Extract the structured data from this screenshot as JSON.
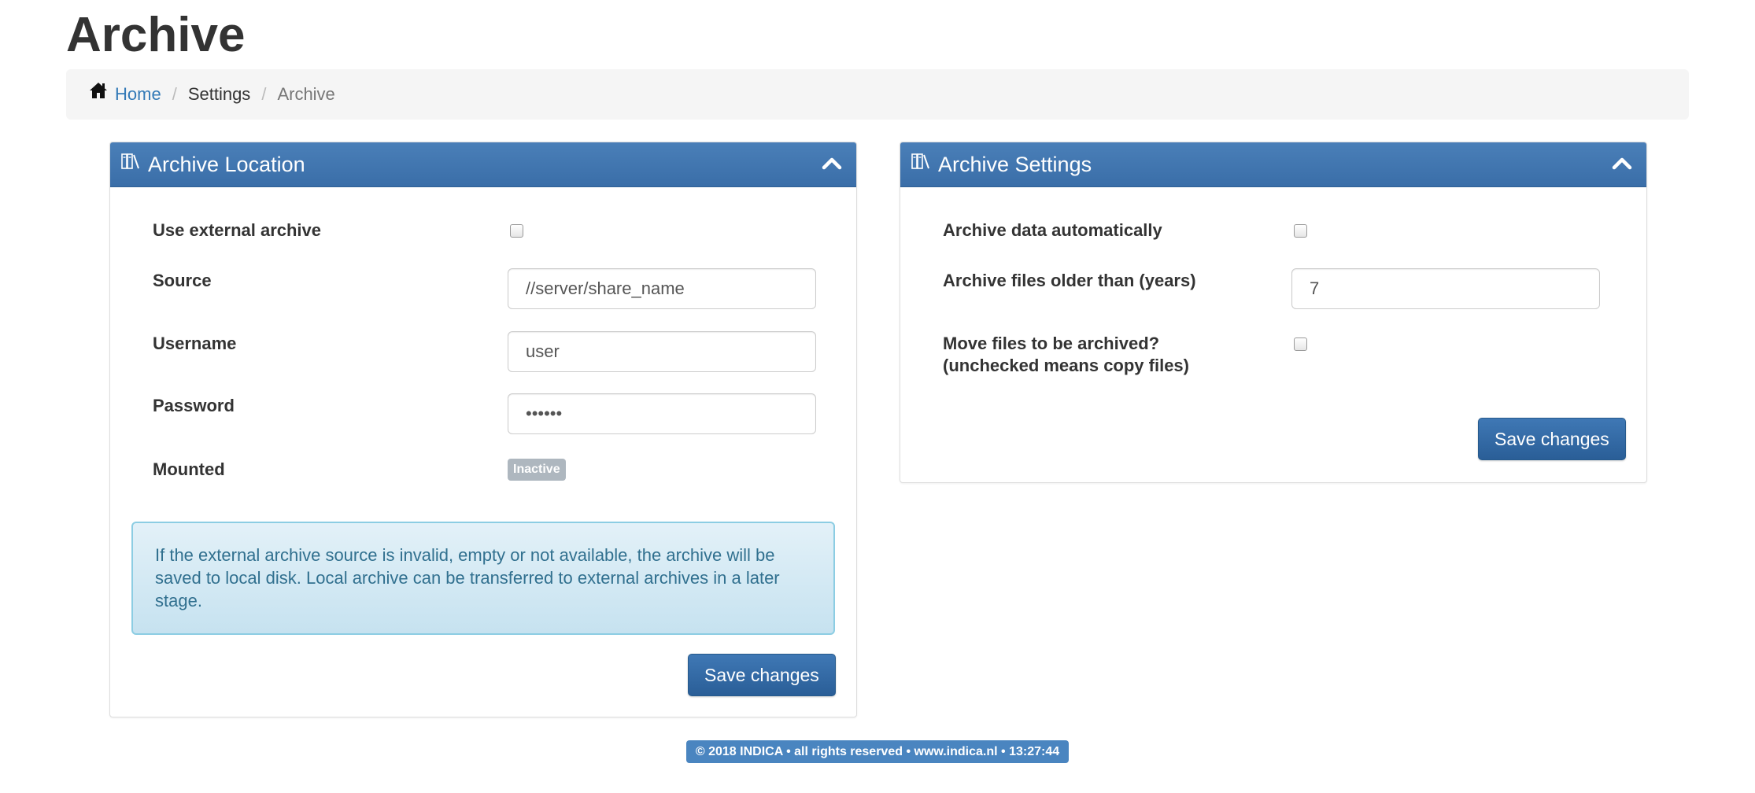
{
  "page": {
    "title": "Archive"
  },
  "breadcrumb": {
    "home_icon": "home-icon",
    "items": [
      "Home",
      "Settings",
      "Archive"
    ],
    "separator": "/"
  },
  "archive_location": {
    "title": "Archive Location",
    "icon": "archive-books-icon",
    "collapse_icon": "chevron-up-icon",
    "fields": {
      "use_external": {
        "label": "Use external archive",
        "checked": false
      },
      "source": {
        "label": "Source",
        "value": "//server/share_name"
      },
      "username": {
        "label": "Username",
        "value": "user"
      },
      "password": {
        "label": "Password",
        "value": "••••••"
      },
      "mounted": {
        "label": "Mounted",
        "status": "Inactive"
      }
    },
    "info_text": "If the external archive source is invalid, empty or not available, the archive will be saved to local disk. Local archive can be transferred to external archives in a later stage.",
    "save_label": "Save changes"
  },
  "archive_settings": {
    "title": "Archive Settings",
    "icon": "archive-books-icon",
    "collapse_icon": "chevron-up-icon",
    "fields": {
      "auto_archive": {
        "label": "Archive data automatically",
        "checked": false
      },
      "older_than": {
        "label": "Archive files older than (years)",
        "value": "7"
      },
      "move_files": {
        "label_line1": "Move files to be archived?",
        "label_line2": "(unchecked means copy files)",
        "checked": false
      }
    },
    "save_label": "Save changes"
  },
  "footer": {
    "text": "© 2018 INDICA • all rights reserved • www.indica.nl • 13:27:44"
  },
  "colors": {
    "panel_header": "#3a6ea8",
    "link": "#337ab7",
    "info_text": "#31708f",
    "footer_badge": "#4a85c0",
    "inactive_badge": "#aeb7bf"
  }
}
